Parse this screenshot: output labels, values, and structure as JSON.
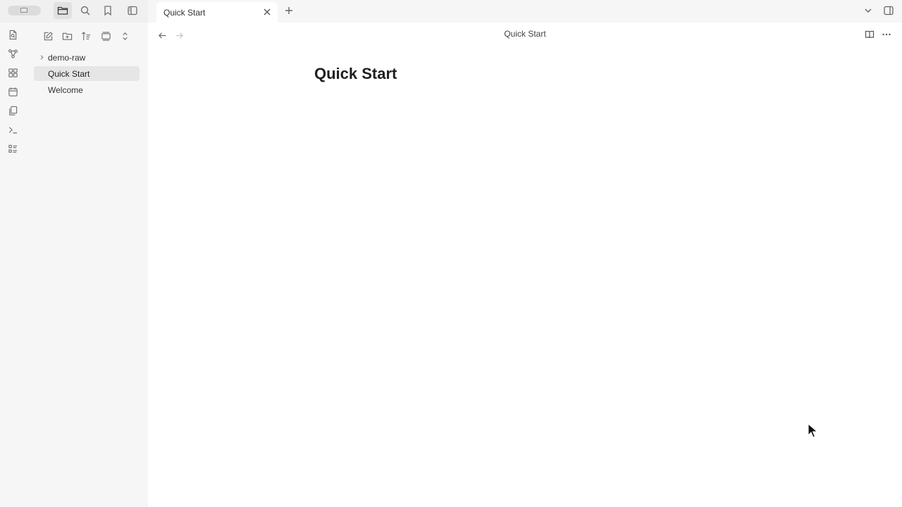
{
  "titlebar": {
    "tab_title": "Quick Start"
  },
  "header": {
    "view_title": "Quick Start"
  },
  "file_tree": {
    "items": [
      {
        "label": "demo-raw",
        "type": "folder",
        "collapsed": true
      },
      {
        "label": "Quick Start",
        "type": "file",
        "selected": true
      },
      {
        "label": "Welcome",
        "type": "file"
      }
    ]
  },
  "note": {
    "title": "Quick Start"
  },
  "icons": {
    "titlebar": [
      "folder-icon",
      "search-icon",
      "bookmark-icon",
      "sidebar-toggle-icon",
      "close-icon",
      "plus-icon",
      "chevron-down-icon",
      "right-sidebar-icon"
    ],
    "ribbon": [
      "open-switcher-icon",
      "graph-view-icon",
      "canvas-icon",
      "daily-note-icon",
      "templates-icon",
      "command-palette-icon",
      "outline-icon"
    ],
    "explorer_toolbar": [
      "new-note-icon",
      "new-folder-icon",
      "sort-icon",
      "collapse-all-icon",
      "expand-icon"
    ],
    "main": [
      "arrow-left-icon",
      "arrow-right-icon",
      "book-icon",
      "more-options-icon"
    ]
  }
}
